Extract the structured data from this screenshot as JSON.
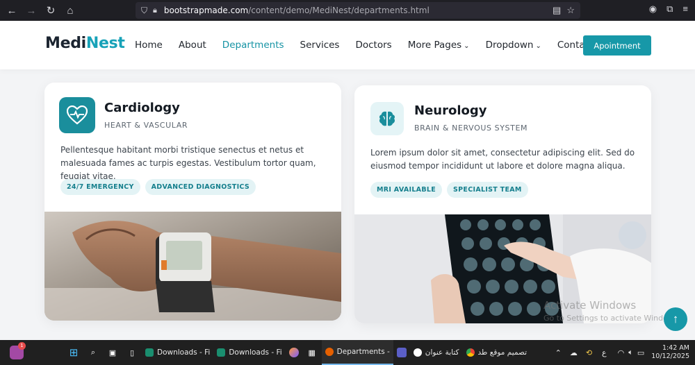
{
  "browser": {
    "url_host": "bootstrapmade.com",
    "url_path": "/content/demo/MediNest/departments.html"
  },
  "header": {
    "logo_part1": "Medi",
    "logo_part2": "Nest",
    "menu": [
      {
        "label": "Home"
      },
      {
        "label": "About"
      },
      {
        "label": "Departments"
      },
      {
        "label": "Services"
      },
      {
        "label": "Doctors"
      },
      {
        "label": "More Pages"
      },
      {
        "label": "Dropdown"
      },
      {
        "label": "Contact"
      }
    ],
    "cta": "Apointment"
  },
  "cards": [
    {
      "title": "Cardiology",
      "subtitle": "HEART & VASCULAR",
      "description": "Pellentesque habitant morbi tristique senectus et netus et malesuada fames ac turpis egestas. Vestibulum tortor quam, feugiat vitae.",
      "tags": [
        "24/7 EMERGENCY",
        "ADVANCED DIAGNOSTICS"
      ],
      "icon": "heart-pulse-icon"
    },
    {
      "title": "Neurology",
      "subtitle": "BRAIN & NERVOUS SYSTEM",
      "description": "Lorem ipsum dolor sit amet, consectetur adipiscing elit. Sed do eiusmod tempor incididunt ut labore et dolore magna aliqua.",
      "tags": [
        "MRI AVAILABLE",
        "SPECIALIST TEAM"
      ],
      "icon": "brain-icon"
    }
  ],
  "watermark": {
    "line1": "Activate Windows",
    "line2": "Go to Settings to activate Windows."
  },
  "taskbar": {
    "badge_count": "1",
    "apps": [
      {
        "label": "Downloads - Fi"
      },
      {
        "label": "Downloads - Fi"
      },
      {
        "label": "Departments -"
      },
      {
        "label": "كتابة عنوان"
      },
      {
        "label": "تصميم موقع طد"
      }
    ],
    "lang": "ع",
    "time": "1:42 AM",
    "date": "10/12/2025"
  },
  "colors": {
    "accent": "#1798a8",
    "logo_accent": "#17a2b8"
  }
}
